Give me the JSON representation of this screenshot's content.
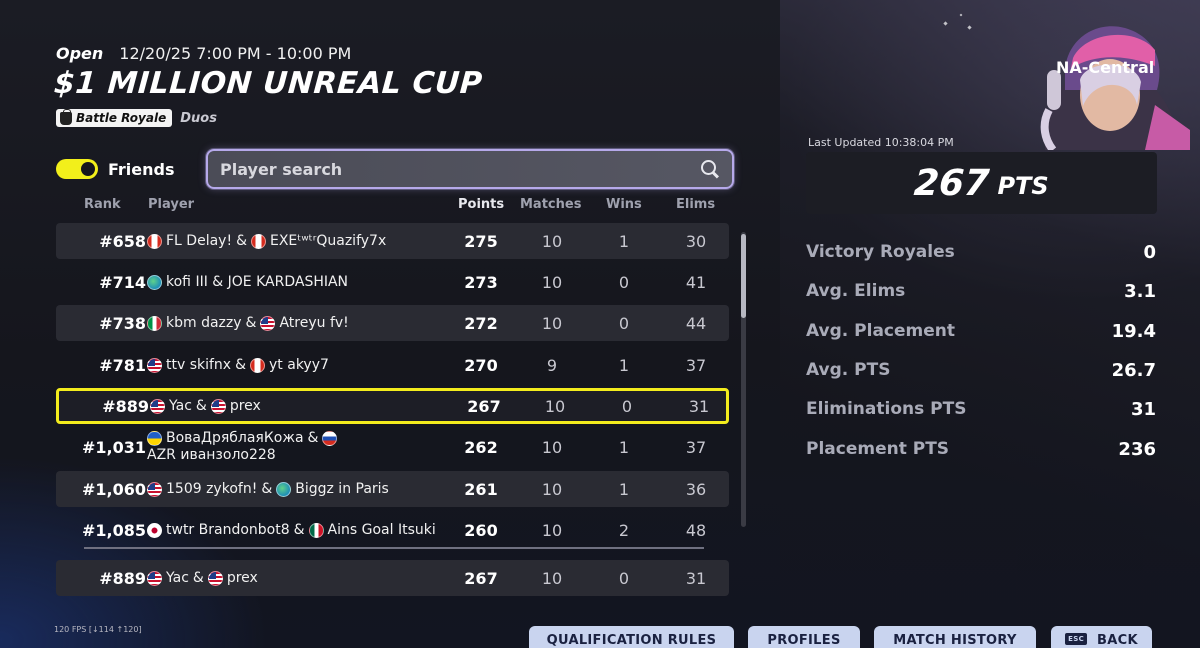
{
  "event": {
    "status": "Open",
    "time": "12/20/25 7:00 PM - 10:00 PM",
    "title": "$1 MILLION UNREAL CUP",
    "mode": "Battle Royale",
    "team": "Duos"
  },
  "friends_toggle": {
    "label": "Friends",
    "on": true
  },
  "search": {
    "placeholder": "Player search",
    "value": ""
  },
  "columns": {
    "rank": "Rank",
    "player": "Player",
    "points": "Points",
    "matches": "Matches",
    "wins": "Wins",
    "elims": "Elims"
  },
  "rows": [
    {
      "rank": "#658",
      "p1_flag": "flag-ca",
      "p1": "FL Delay!",
      "p2_flag": "flag-ca",
      "p2": "EXEᵗʷᵗʳQuazify7x",
      "points": "275",
      "matches": "10",
      "wins": "1",
      "elims": "30"
    },
    {
      "rank": "#714",
      "p1_flag": "flag-globe",
      "p1": "kofi III & JOE KARDASHIAN",
      "p2_flag": "",
      "p2": "",
      "points": "273",
      "matches": "10",
      "wins": "0",
      "elims": "41"
    },
    {
      "rank": "#738",
      "p1_flag": "flag-it",
      "p1": "kbm dazzy",
      "p2_flag": "flag-us",
      "p2": "Atreyu fv!",
      "points": "272",
      "matches": "10",
      "wins": "0",
      "elims": "44"
    },
    {
      "rank": "#781",
      "p1_flag": "flag-us",
      "p1": "ttv skifnx",
      "p2_flag": "flag-ca",
      "p2": "yt akyy7",
      "points": "270",
      "matches": "9",
      "wins": "1",
      "elims": "37"
    },
    {
      "rank": "#889",
      "p1_flag": "flag-us",
      "p1": "Yac",
      "p2_flag": "flag-us",
      "p2": "prex",
      "points": "267",
      "matches": "10",
      "wins": "0",
      "elims": "31"
    },
    {
      "rank": "#1,031",
      "p1_flag": "flag-ua",
      "p1": "ВоваДряблаяКожа",
      "p2_flag": "flag-ru",
      "p2": "AZR иванзоло228",
      "points": "262",
      "matches": "10",
      "wins": "1",
      "elims": "37"
    },
    {
      "rank": "#1,060",
      "p1_flag": "flag-us",
      "p1": "1509 zykofn!",
      "p2_flag": "flag-globe",
      "p2": "Biggz in Paris",
      "points": "261",
      "matches": "10",
      "wins": "1",
      "elims": "36"
    },
    {
      "rank": "#1,085",
      "p1_flag": "flag-jp",
      "p1": "twtr Brandonbot8",
      "p2_flag": "flag-mx",
      "p2": "Ains Goal Itsuki",
      "points": "260",
      "matches": "10",
      "wins": "2",
      "elims": "48"
    }
  ],
  "my_row": {
    "rank": "#889",
    "p1_flag": "flag-us",
    "p1": "Yac",
    "p2_flag": "flag-us",
    "p2": "prex",
    "points": "267",
    "matches": "10",
    "wins": "0",
    "elims": "31"
  },
  "highlight_rank": "#889",
  "region": "NA-Central",
  "last_updated": "Last Updated 10:38:04 PM",
  "total": {
    "value": "267",
    "unit": "PTS"
  },
  "stats": [
    {
      "label": "Victory Royales",
      "value": "0"
    },
    {
      "label": "Avg. Elims",
      "value": "3.1"
    },
    {
      "label": "Avg. Placement",
      "value": "19.4"
    },
    {
      "label": "Avg. PTS",
      "value": "26.7"
    },
    {
      "label": "Eliminations PTS",
      "value": "31"
    },
    {
      "label": "Placement PTS",
      "value": "236"
    }
  ],
  "fps": "120 FPS [↓114 ↑120]",
  "bottom_buttons": {
    "qualification_rules": "QUALIFICATION RULES",
    "profiles": "PROFILES",
    "match_history": "MATCH HISTORY",
    "esc_key": "ESC",
    "back": "BACK"
  },
  "colors": {
    "highlight": "#f3ec1d",
    "toggle": "#f2ef1b",
    "search_border": "#b6a9ea",
    "button_bg": "#c9d4ef"
  }
}
